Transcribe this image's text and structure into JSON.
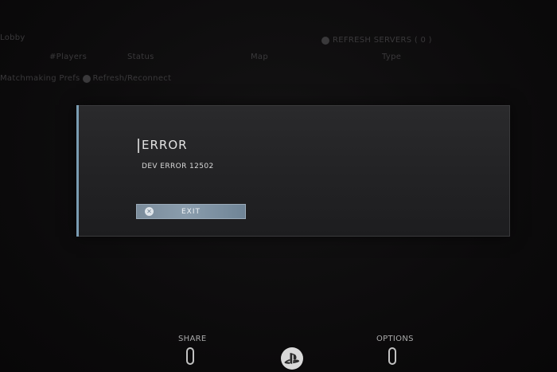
{
  "background": {
    "title": "Lobby",
    "refresh": "REFRESH SERVERS ( 0 )",
    "columns": {
      "players": "#Players",
      "status": "Status",
      "map": "Map",
      "type": "Type"
    },
    "hint": "Matchmaking Prefs",
    "hint_action": "Refresh/Reconnect"
  },
  "dialog": {
    "title": "ERROR",
    "message": "DEV ERROR 12502",
    "exit_label": "EXIT",
    "exit_icon": "cross-icon",
    "accent_color": "#7a9cb2"
  },
  "controller": {
    "share_label": "SHARE",
    "options_label": "OPTIONS",
    "ps_icon": "playstation-logo-icon"
  }
}
